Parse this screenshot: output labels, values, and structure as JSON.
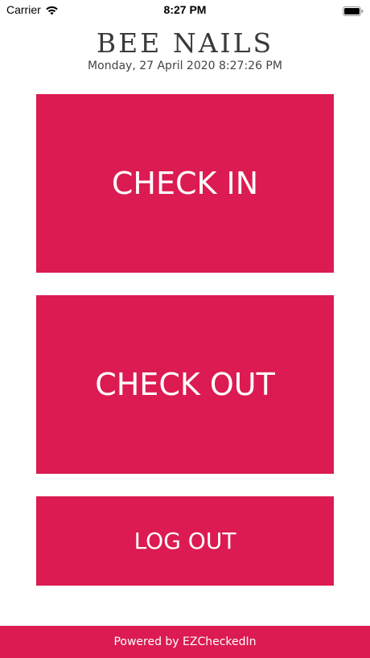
{
  "status_bar": {
    "carrier": "Carrier",
    "time": "8:27 PM",
    "wifi_icon": "wifi-icon",
    "battery_icon": "battery-icon"
  },
  "header": {
    "title": "BEE NAILS",
    "datetime": "Monday, 27 April 2020 8:27:26 PM"
  },
  "buttons": {
    "check_in": "CHECK IN",
    "check_out": "CHECK OUT",
    "log_out": "LOG OUT"
  },
  "footer": {
    "text": "Powered by EZCheckedIn"
  },
  "colors": {
    "accent": "#db1b51",
    "title_text": "#3a3a3a"
  }
}
